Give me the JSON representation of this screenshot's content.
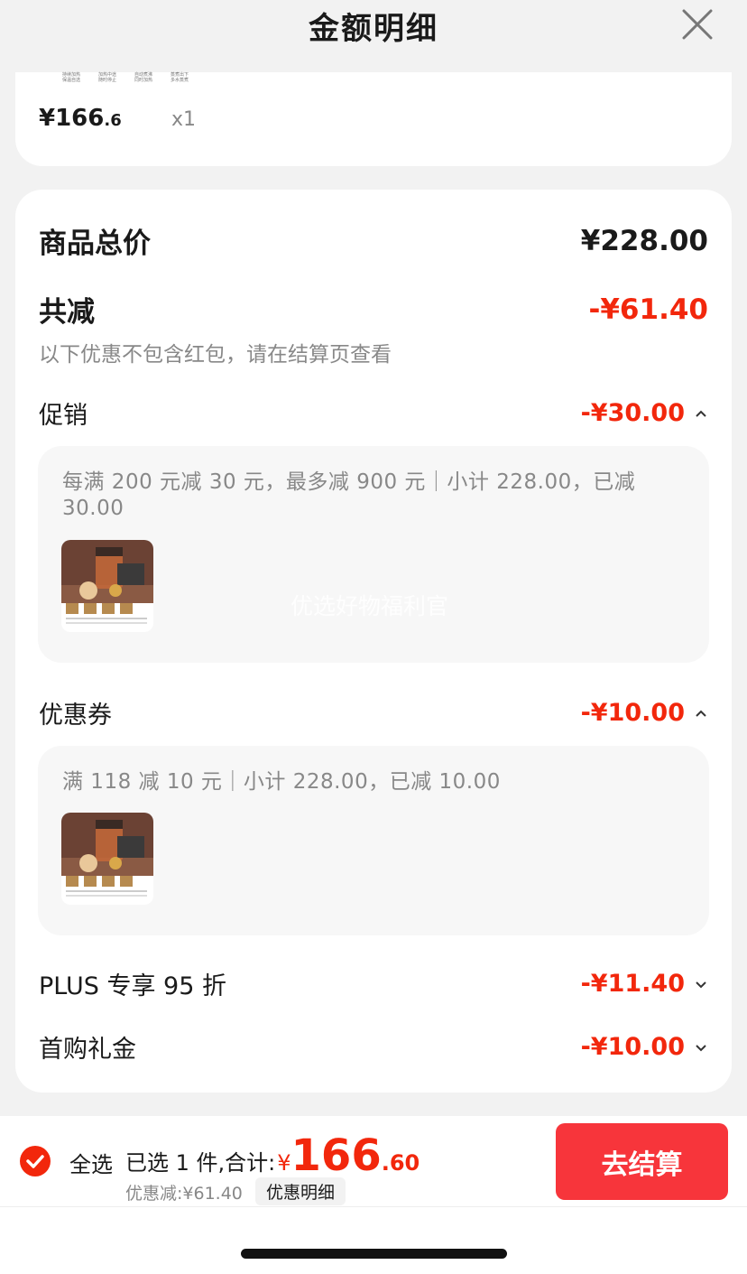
{
  "header": {
    "title": "金额明细"
  },
  "top_item": {
    "captions": [
      "持续加热 保温自选",
      "加热中途 随时停止",
      "自动煮沸 同时加热",
      "蒸煮出下 多水蒸煮"
    ],
    "price_int": "¥166",
    "price_dec": ".6",
    "quantity": "x1"
  },
  "summary": {
    "total_label": "商品总价",
    "total_value": "¥228.00",
    "reduce_label": "共减",
    "reduce_value": "-¥61.40",
    "note": "以下优惠不包含红包，请在结算页查看"
  },
  "promo": {
    "label": "促销",
    "value": "-¥30.00",
    "desc": "每满 200 元减 30 元，最多减 900 元｜小计 228.00，已减 30.00",
    "watermark": "优选好物福利官"
  },
  "coupon": {
    "label": "优惠券",
    "value": "-¥10.00",
    "desc": "满 118 减 10 元｜小计 228.00，已减 10.00"
  },
  "plus": {
    "label": "PLUS 专享 95 折",
    "value": "-¥11.40"
  },
  "first_purchase": {
    "label": "首购礼金",
    "value": "-¥10.00"
  },
  "bottom_bar": {
    "select_all": "全选",
    "selected_text": "已选 1 件,合计:",
    "total_symbol": "¥",
    "total_int": "166",
    "total_dec": ".60",
    "discount_text": "优惠减:¥61.40",
    "detail_button": "优惠明细",
    "checkout_button": "去结算"
  },
  "colors": {
    "accent_red": "#f2270c",
    "checkout_bg": "#f7353b"
  }
}
